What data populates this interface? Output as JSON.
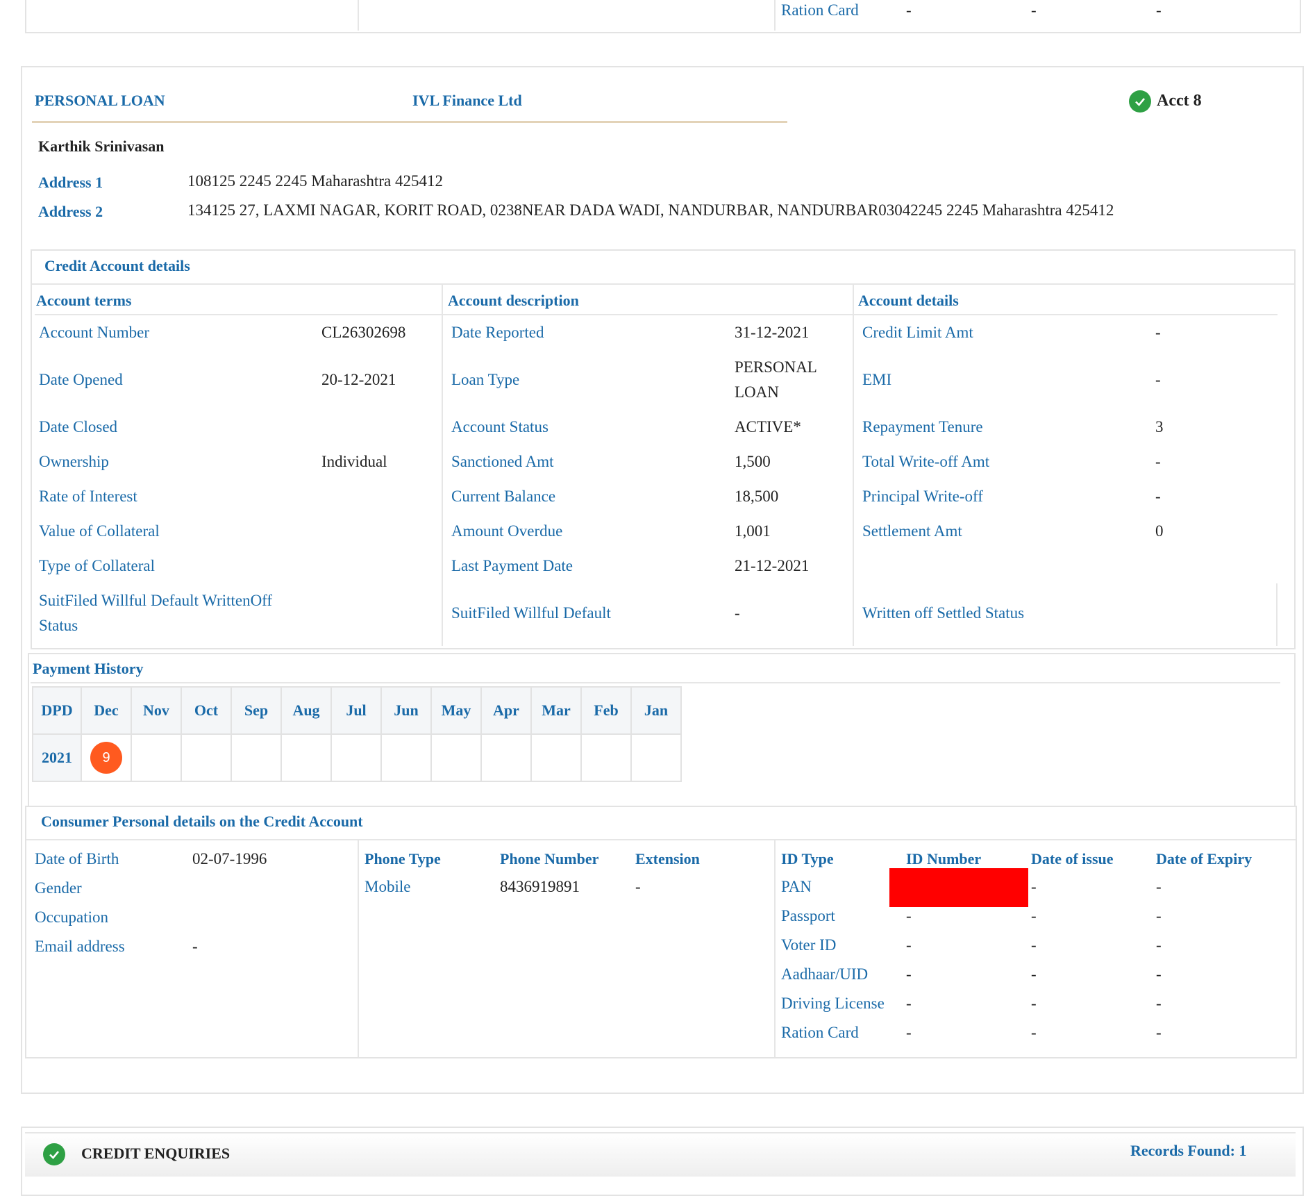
{
  "top_fragment": {
    "label": "Ration Card",
    "v1": "-",
    "v2": "-",
    "v3": "-"
  },
  "account": {
    "loan_type_header": "PERSONAL LOAN",
    "lender": "IVL Finance Ltd",
    "acct_label": "Acct 8",
    "holder_name": "Karthik Srinivasan",
    "address1_label": "Address 1",
    "address1": "108125 2245 2245 Maharashtra 425412",
    "address2_label": "Address 2",
    "address2": "134125 27, LAXMI NAGAR, KORIT ROAD, 0238NEAR DADA WADI, NANDURBAR, NANDURBAR03042245 2245 Maharashtra 425412"
  },
  "credit_details": {
    "title": "Credit Account details",
    "terms_header": "Account terms",
    "description_header": "Account description",
    "details_header": "Account details",
    "terms": [
      {
        "label": "Account Number",
        "value": "CL26302698"
      },
      {
        "label": "Date Opened",
        "value": "20-12-2021"
      },
      {
        "label": "Date Closed",
        "value": ""
      },
      {
        "label": "Ownership",
        "value": "Individual"
      },
      {
        "label": "Rate of Interest",
        "value": ""
      },
      {
        "label": "Value of Collateral",
        "value": ""
      },
      {
        "label": "Type of Collateral",
        "value": ""
      },
      {
        "label_line1": "SuitFiled Willful Default WrittenOff",
        "label_line2": "Status",
        "value": ""
      }
    ],
    "description": [
      {
        "label": "Date Reported",
        "value": "31-12-2021"
      },
      {
        "label": "Loan Type",
        "value_line1": "PERSONAL",
        "value_line2": "LOAN"
      },
      {
        "label": "Account Status",
        "value": "ACTIVE*"
      },
      {
        "label": "Sanctioned Amt",
        "value": "1,500"
      },
      {
        "label": "Current Balance",
        "value": "18,500"
      },
      {
        "label": "Amount Overdue",
        "value": "1,001"
      },
      {
        "label": "Last Payment Date",
        "value": "21-12-2021"
      },
      {
        "label": "SuitFiled Willful Default",
        "value": "-"
      }
    ],
    "details": [
      {
        "label": "Credit Limit Amt",
        "value": "-"
      },
      {
        "label": "EMI",
        "value": "-"
      },
      {
        "label": "Repayment Tenure",
        "value": "3"
      },
      {
        "label": "Total Write-off Amt",
        "value": "-"
      },
      {
        "label": "Principal Write-off",
        "value": "-"
      },
      {
        "label": "Settlement Amt",
        "value": "0"
      },
      {
        "label": "Written off Settled Status",
        "value": ""
      }
    ]
  },
  "payment_history": {
    "title": "Payment History",
    "corner": "DPD",
    "months": [
      "Dec",
      "Nov",
      "Oct",
      "Sep",
      "Aug",
      "Jul",
      "Jun",
      "May",
      "Apr",
      "Mar",
      "Feb",
      "Jan"
    ],
    "year": "2021",
    "dec_dpd": "9"
  },
  "personal": {
    "title": "Consumer Personal details on the Credit Account",
    "dob_label": "Date of Birth",
    "dob": "02-07-1996",
    "gender_label": "Gender",
    "occupation_label": "Occupation",
    "email_label": "Email address",
    "email": "-",
    "phone_type_header": "Phone Type",
    "phone_number_header": "Phone Number",
    "extension_header": "Extension",
    "phone_type": "Mobile",
    "phone_number": "8436919891",
    "extension": "-",
    "id_type_header": "ID Type",
    "id_number_header": "ID Number",
    "date_issue_header": "Date of issue",
    "date_expiry_header": "Date of Expiry",
    "ids": [
      {
        "type": "PAN",
        "number": "",
        "issue": "-",
        "expiry": "-"
      },
      {
        "type": "Passport",
        "number": "-",
        "issue": "-",
        "expiry": "-"
      },
      {
        "type": "Voter ID",
        "number": "-",
        "issue": "-",
        "expiry": "-"
      },
      {
        "type": "Aadhaar/UID",
        "number": "-",
        "issue": "-",
        "expiry": "-"
      },
      {
        "type": "Driving License",
        "number": "-",
        "issue": "-",
        "expiry": "-"
      },
      {
        "type": "Ration Card",
        "number": "-",
        "issue": "-",
        "expiry": "-"
      }
    ]
  },
  "enquiries": {
    "title": "CREDIT ENQUIRIES",
    "records": "Records Found: 1"
  },
  "colors": {
    "label_blue": "#1a6aa8",
    "dpd_orange": "#ff5a1f",
    "check_green": "#2ea044",
    "redaction": "#ff0000"
  }
}
